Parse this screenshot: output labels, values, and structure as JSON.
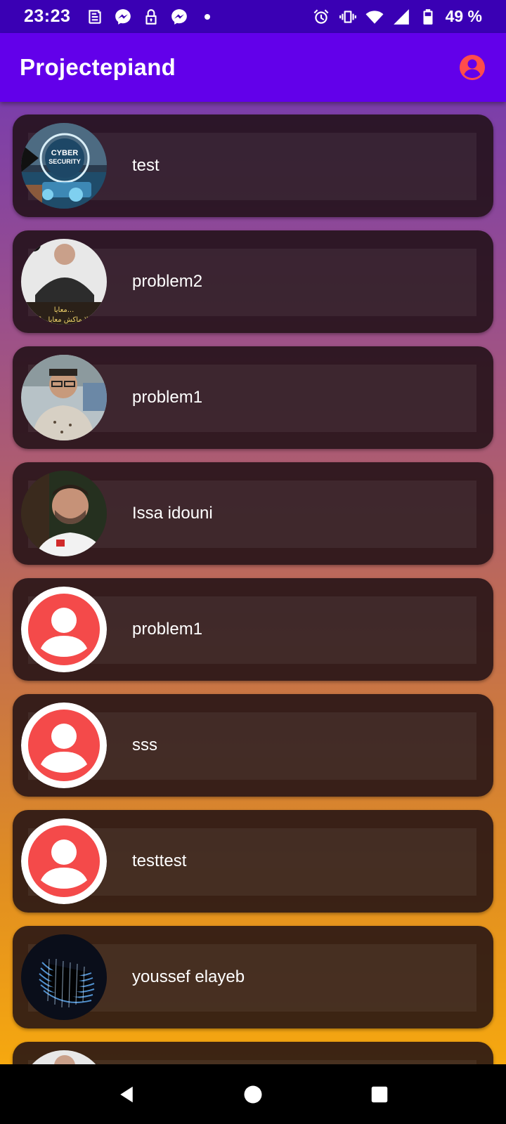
{
  "status_bar": {
    "time": "23:23",
    "battery": "49 %",
    "left_icons": [
      "news-icon",
      "messenger-icon",
      "lock-icon",
      "messenger-icon",
      "dot-icon"
    ],
    "right_icons": [
      "alarm-icon",
      "vibrate-icon",
      "wifi-icon",
      "signal-icon",
      "battery-icon"
    ]
  },
  "app_bar": {
    "title": "Projectepiand",
    "action_icon": "account-circle-icon",
    "action_color": "#ff4c4c"
  },
  "colors": {
    "status_bar": "#3a00b4",
    "app_bar": "#6200ea",
    "gradient_top": "#7b3eaa",
    "gradient_bottom": "#f6a80f",
    "default_avatar": "#f44a4a"
  },
  "list": {
    "items": [
      {
        "name": "test",
        "avatar": "photo-cyber-security"
      },
      {
        "name": "problem2",
        "avatar": "photo-man-leather-jacket"
      },
      {
        "name": "problem1",
        "avatar": "photo-man-glasses"
      },
      {
        "name": "Issa idouni",
        "avatar": "photo-football-player"
      },
      {
        "name": "problem1",
        "avatar": "default-person-icon"
      },
      {
        "name": "sss",
        "avatar": "default-person-icon"
      },
      {
        "name": "testtest",
        "avatar": "default-person-icon"
      },
      {
        "name": "youssef elayeb",
        "avatar": "photo-blue-fiber"
      },
      {
        "name": "",
        "avatar": "photo-partial"
      }
    ]
  },
  "nav_bar": {
    "buttons": [
      "back-icon",
      "home-icon",
      "recents-icon"
    ]
  }
}
